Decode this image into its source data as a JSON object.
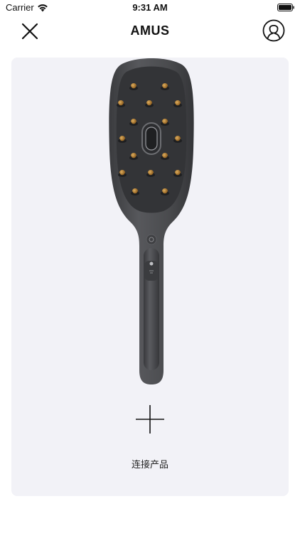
{
  "status_bar": {
    "carrier": "Carrier",
    "time": "9:31 AM"
  },
  "nav": {
    "title": "AMUS",
    "close_icon": "close-icon",
    "profile_icon": "user-profile-icon"
  },
  "card": {
    "image": "hair-brush-product-image",
    "add_icon": "plus-icon",
    "connect_label": "连接产品"
  },
  "colors": {
    "card_background": "#f2f2f7",
    "brush_body": "#4a4b4e",
    "brush_pins": "#b8862f"
  }
}
